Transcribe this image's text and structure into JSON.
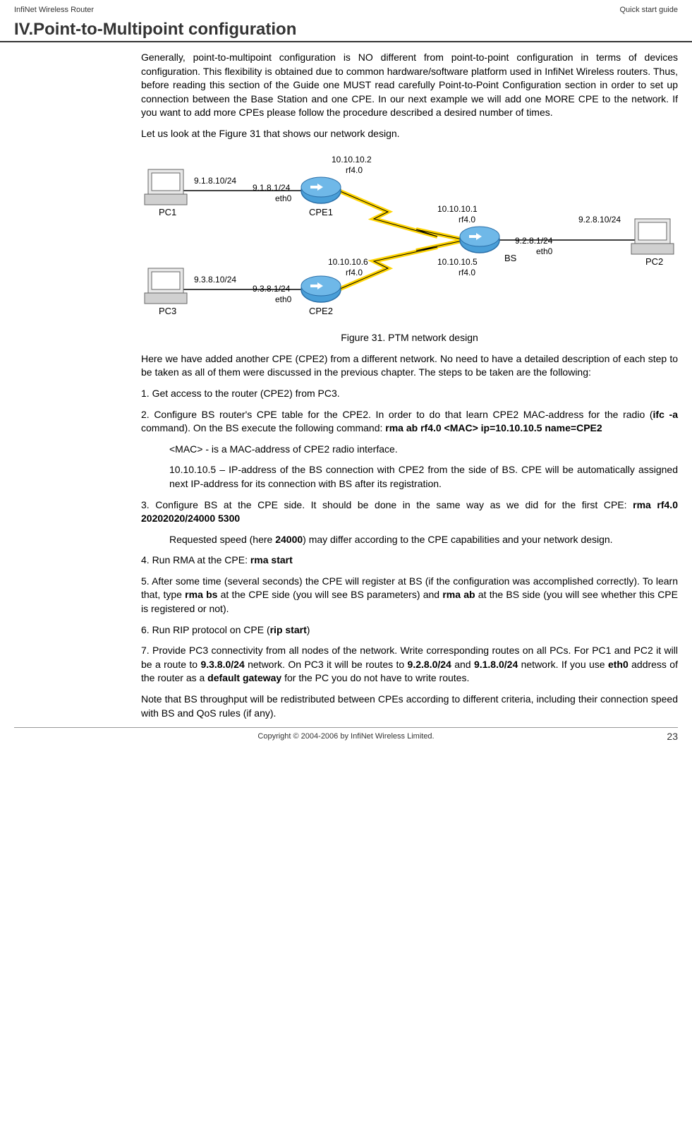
{
  "header": {
    "left": "InfiNet Wireless Router",
    "right": "Quick start guide"
  },
  "heading": "IV.Point-to-Multipoint configuration",
  "para1": "Generally, point-to-multipoint configuration is NO different from point-to-point configuration in terms of devices configuration. This flexibility is obtained due to common hardware/software platform used in InfiNet Wireless routers. Thus, before reading this section of the Guide one MUST read carefully Point-to-Point Configuration section in order to set up connection between the Base Station and one CPE. In our next example we will add one MORE CPE to the network. If you want to add more CPEs please follow the procedure described a desired number of times.",
  "para2": "Let us look at the Figure 31 that shows our network design.",
  "figure": {
    "caption": "Figure 31. PTM network design",
    "labels": {
      "pc1": "PC1",
      "pc2": "PC2",
      "pc3": "PC3",
      "cpe1": "CPE1",
      "cpe2": "CPE2",
      "bs": "BS",
      "ip_pc1": "9.1.8.10/24",
      "ip_cpe1_eth": "9.1.8.1/24",
      "eth0_1": "eth0",
      "ip_cpe1_rf": "10.10.10.2",
      "rf40_1": "rf4.0",
      "ip_bs_rf_top": "10.10.10.1",
      "rf40_2": "rf4.0",
      "ip_bs_eth": "9.2.8.1/24",
      "eth0_2": "eth0",
      "ip_pc2": "9.2.8.10/24",
      "ip_pc3": "9.3.8.10/24",
      "ip_cpe2_eth": "9.3.8.1/24",
      "eth0_3": "eth0",
      "ip_cpe2_rf": "10.10.10.6",
      "rf40_3": "rf4.0",
      "ip_bs_rf_bot": "10.10.10.5",
      "rf40_4": "rf4.0"
    }
  },
  "para3": "Here we have added another CPE (CPE2) from a different network. No need to have a detailed description of each step to be taken as all of them were discussed in the previous chapter. The steps to be taken are the following:",
  "step1": "1. Get access to the router (CPE2) from PC3.",
  "step2_a": "2. Configure BS router's CPE table for the CPE2. In order to do that learn CPE2 MAC-address for the radio (",
  "step2_cmd1": "ifc -a",
  "step2_b": " command). On the BS execute the following command: ",
  "step2_cmd2": "rma ab rf4.0 <MAC> ip=10.10.10.5 name=CPE2",
  "step2_note1": "<MAC> - is a MAC-address of CPE2 radio interface.",
  "step2_note2": "10.10.10.5 – IP-address of the BS connection with CPE2 from the side of BS. CPE will be automatically assigned next IP-address for its connection with BS after its registration.",
  "step3_a": "3. Configure BS at the CPE side. It should be done in the same way as we did for the first CPE: ",
  "step3_cmd": "rma rf4.0 20202020/24000 5300",
  "step3_note_a": "Requested speed (here ",
  "step3_note_num": "24000",
  "step3_note_b": ") may differ according to the CPE capabilities and your network design.",
  "step4_a": "4. Run RMA at the CPE: ",
  "step4_cmd": "rma start",
  "step5_a": "5. After some time (several seconds) the CPE will register at BS (if the configuration was accomplished correctly). To learn that, type ",
  "step5_cmd1": "rma bs",
  "step5_b": " at the CPE side (you will see BS parameters) and ",
  "step5_cmd2": "rma ab",
  "step5_c": " at the BS side (you will see whether this CPE is registered or not).",
  "step6_a": "6. Run RIP protocol on CPE (",
  "step6_cmd": "rip start",
  "step6_b": ")",
  "step7_a": "7. Provide PC3 connectivity from all nodes of the network. Write corresponding routes on all PCs. For PC1 and PC2 it will be a route to ",
  "step7_net1": "9.3.8.0/24",
  "step7_b": " network. On PC3 it will be routes to ",
  "step7_net2": "9.2.8.0/24",
  "step7_c": " and ",
  "step7_net3": "9.1.8.0/24",
  "step7_d": " network. If you use ",
  "step7_eth": "eth0",
  "step7_e": " address of the router as a ",
  "step7_gw": "default gateway",
  "step7_f": " for the PC you do not have to write routes.",
  "para_last": "Note that BS throughput will be redistributed between CPEs according to different criteria, including their connection speed with BS and QoS rules (if any).",
  "footer": {
    "copyright": "Copyright © 2004-2006 by InfiNet Wireless Limited.",
    "page": "23"
  }
}
